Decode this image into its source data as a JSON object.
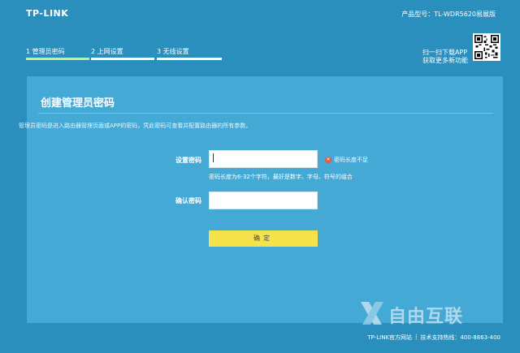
{
  "header": {
    "brand": "TP-LINK",
    "model_label": "产品型号：TL-WDR5620易展版"
  },
  "steps": [
    {
      "label": "1 管理员密码",
      "active": true
    },
    {
      "label": "2 上网设置",
      "active": false
    },
    {
      "label": "3 无线设置",
      "active": false
    }
  ],
  "qr": {
    "line1": "扫一扫下载APP",
    "line2": "获取更多新功能"
  },
  "panel": {
    "title": "创建管理员密码",
    "description": "管理员密码是进入路由器管理页面或APP的密码，凭此密码可查看并配置路由器的所有参数。",
    "set_password_label": "设置密码",
    "set_password_value": "",
    "error_text": "密码长度不足",
    "hint_text": "密码长度为6-32个字符，最好是数字、字母、符号的组合",
    "confirm_password_label": "确认密码",
    "confirm_password_value": "",
    "confirm_button": "确定"
  },
  "watermark": {
    "text": "自由互联"
  },
  "footer": {
    "site_link": "TP-LINK官方网站",
    "separator": "|",
    "support": "技术支持热线：400-8863-400"
  },
  "colors": {
    "background": "#2a8fbd",
    "panel": "#45a9d6",
    "button": "#f5e34c",
    "error": "#e55a3c",
    "active_step": "#c8f07a"
  }
}
